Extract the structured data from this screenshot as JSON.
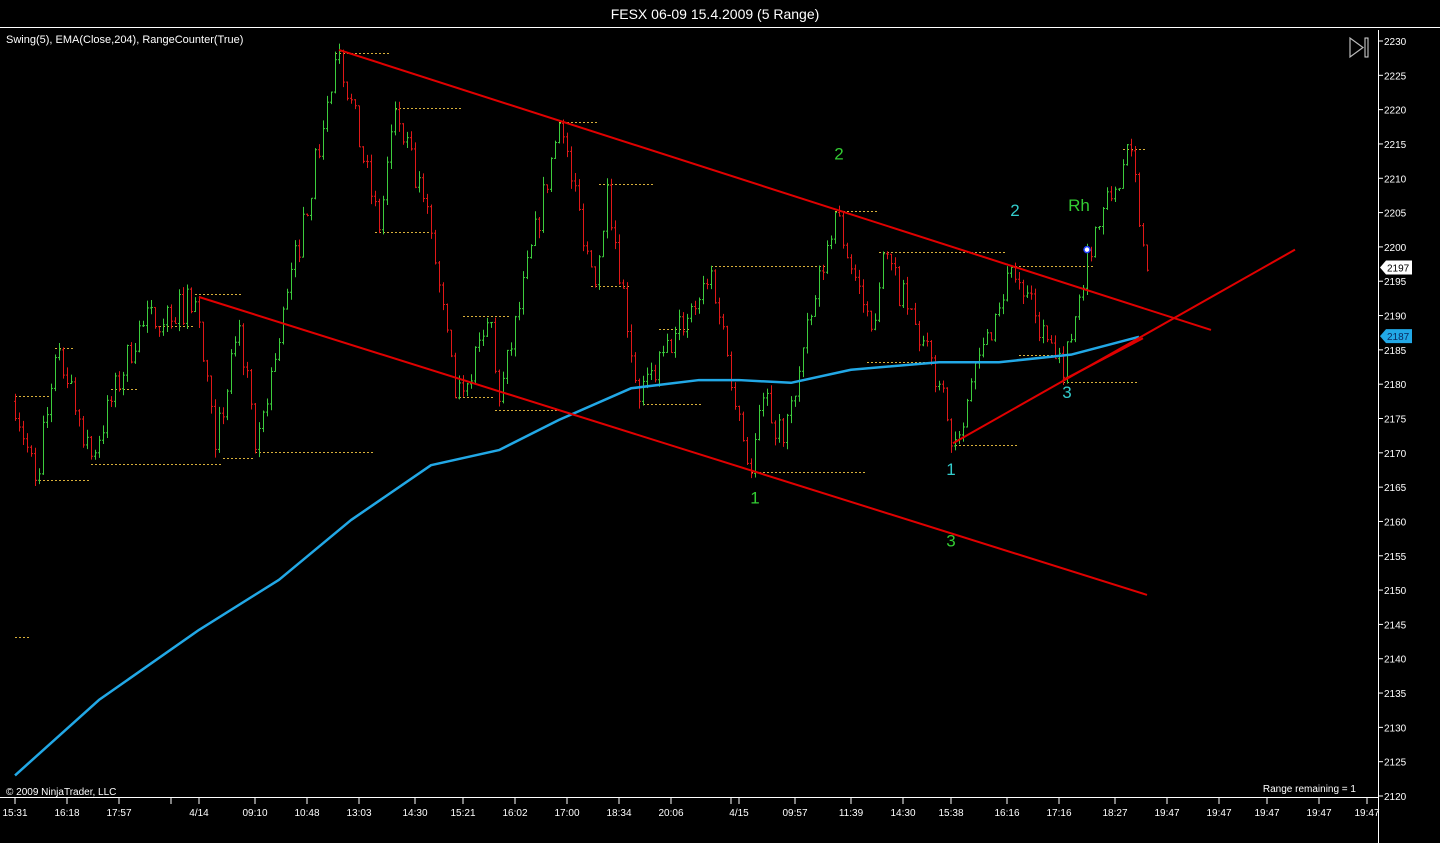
{
  "window": {
    "title": "FESX 06-09  15.4.2009 (5 Range)"
  },
  "indicators_label": "Swing(5), EMA(Close,204), RangeCounter(True)",
  "copyright": "© 2009 NinjaTrader, LLC",
  "range_remaining": "Range remaining = 1",
  "colors": {
    "up": "#3ccc3c",
    "down": "#e01818",
    "ema": "#22a8e6",
    "trend": "#e00000",
    "swing": "#d8b03a",
    "green_label": "#33cc33",
    "cyan_label": "#33cccc"
  },
  "chart_data": {
    "type": "line",
    "title": "FESX 06-09  15.4.2009 (5 Range)",
    "ylim": [
      2120,
      2230
    ],
    "yticks": [
      2230,
      2225,
      2220,
      2215,
      2210,
      2205,
      2200,
      2195,
      2190,
      2185,
      2180,
      2175,
      2170,
      2165,
      2160,
      2155,
      2150,
      2145,
      2140,
      2135,
      2130,
      2125,
      2120
    ],
    "xlim_bars": [
      0,
      340
    ],
    "xticks": [
      {
        "bar": 0,
        "label": "15:31"
      },
      {
        "bar": 13,
        "label": "16:18"
      },
      {
        "bar": 26,
        "label": "17:57"
      },
      {
        "bar": 39,
        "label": ""
      },
      {
        "bar": 46,
        "label": "4/14"
      },
      {
        "bar": 60,
        "label": "09:10"
      },
      {
        "bar": 73,
        "label": "10:48"
      },
      {
        "bar": 86,
        "label": "13:03"
      },
      {
        "bar": 100,
        "label": "14:30"
      },
      {
        "bar": 112,
        "label": "15:21"
      },
      {
        "bar": 125,
        "label": "16:02"
      },
      {
        "bar": 138,
        "label": "17:00"
      },
      {
        "bar": 151,
        "label": "18:34"
      },
      {
        "bar": 164,
        "label": "20:06"
      },
      {
        "bar": 179,
        "label": ""
      },
      {
        "bar": 181,
        "label": "4/15"
      },
      {
        "bar": 195,
        "label": "09:57"
      },
      {
        "bar": 209,
        "label": "11:39"
      },
      {
        "bar": 222,
        "label": "14:30"
      },
      {
        "bar": 234,
        "label": "15:38"
      },
      {
        "bar": 248,
        "label": "16:16"
      },
      {
        "bar": 261,
        "label": "17:16"
      },
      {
        "bar": 275,
        "label": "18:27"
      },
      {
        "bar": 288,
        "label": "19:47"
      },
      {
        "bar": 301,
        "label": "19:47"
      },
      {
        "bar": 313,
        "label": "19:47"
      },
      {
        "bar": 326,
        "label": "19:47"
      },
      {
        "bar": 338,
        "label": "19:47"
      }
    ],
    "price_path": [
      [
        0,
        2177.5
      ],
      [
        5,
        2166
      ],
      [
        11,
        2185
      ],
      [
        19,
        2169.5
      ],
      [
        31,
        2188.5
      ],
      [
        45,
        2192
      ],
      [
        50,
        2170.5
      ],
      [
        56,
        2188.5
      ],
      [
        60,
        2170.5
      ],
      [
        81,
        2228.5
      ],
      [
        91,
        2202.5
      ],
      [
        95,
        2220
      ],
      [
        104,
        2202
      ],
      [
        110,
        2178
      ],
      [
        119,
        2189
      ],
      [
        121,
        2177.5
      ],
      [
        136,
        2218
      ],
      [
        145,
        2194.5
      ],
      [
        148,
        2209
      ],
      [
        156,
        2177.5
      ],
      [
        174,
        2196.5
      ],
      [
        184,
        2167
      ],
      [
        187,
        2178
      ],
      [
        192,
        2171.5
      ],
      [
        205,
        2205
      ],
      [
        214,
        2188
      ],
      [
        217,
        2199
      ],
      [
        231,
        2180
      ],
      [
        234,
        2171
      ],
      [
        249,
        2197
      ],
      [
        262,
        2181
      ],
      [
        268,
        2199.5
      ],
      [
        279,
        2214
      ],
      [
        283,
        2196.6
      ]
    ],
    "last_price": "2197",
    "ema_last": "2187",
    "series": [
      {
        "name": "EMA(Close,204)",
        "points": [
          [
            0,
            2123
          ],
          [
            21,
            2134
          ],
          [
            46,
            2144.2
          ],
          [
            66,
            2151.5
          ],
          [
            84,
            2160.2
          ],
          [
            104,
            2168.2
          ],
          [
            121,
            2170.4
          ],
          [
            136,
            2174.8
          ],
          [
            154,
            2179.4
          ],
          [
            171,
            2180.6
          ],
          [
            181,
            2180.6
          ],
          [
            194,
            2180.2
          ],
          [
            209,
            2182.1
          ],
          [
            231,
            2183.2
          ],
          [
            246,
            2183.2
          ],
          [
            264,
            2184.3
          ],
          [
            281,
            2186.9
          ]
        ]
      }
    ],
    "trend_lines": [
      {
        "from": [
          81,
          2228.7
        ],
        "to": [
          299,
          2187.9
        ]
      },
      {
        "from": [
          46,
          2192.7
        ],
        "to": [
          283,
          2149.3
        ]
      },
      {
        "from": [
          234.5,
          2171.4
        ],
        "to": [
          320,
          2199.6
        ]
      },
      {
        "from": [
          262,
          2180.6
        ],
        "to": [
          282,
          2186.7
        ]
      }
    ],
    "swing_levels": [
      [
        80,
        94,
        2228.2
      ],
      [
        95,
        112,
        2220.2
      ],
      [
        136,
        146,
        2218.2
      ],
      [
        146,
        160,
        2209.2
      ],
      [
        205,
        216,
        2205.2
      ],
      [
        216,
        248,
        2199.3
      ],
      [
        174,
        203,
        2197.2
      ],
      [
        249,
        270,
        2197.2
      ],
      [
        277,
        283,
        2214.3
      ],
      [
        45,
        57,
        2193.1
      ],
      [
        35,
        45,
        2188.5
      ],
      [
        112,
        124,
        2190
      ],
      [
        10,
        15,
        2185.2
      ],
      [
        24,
        31,
        2179.3
      ],
      [
        161,
        169,
        2188.1
      ],
      [
        0,
        9,
        2178.3
      ],
      [
        5,
        19,
        2166
      ],
      [
        19,
        27,
        2168.4
      ],
      [
        27,
        52,
        2168.4
      ],
      [
        52,
        60,
        2169.2
      ],
      [
        60,
        90,
        2170.1
      ],
      [
        90,
        104,
        2202.2
      ],
      [
        144,
        154,
        2194.3
      ],
      [
        110,
        120,
        2178.1
      ],
      [
        120,
        136,
        2176.2
      ],
      [
        157,
        172,
        2177.1
      ],
      [
        184,
        213,
        2167.2
      ],
      [
        213,
        232,
        2183.2
      ],
      [
        235,
        251,
        2171.1
      ],
      [
        251,
        261,
        2184.2
      ],
      [
        262,
        281,
        2180.3
      ],
      [
        0,
        4,
        2143.2
      ]
    ],
    "annotations": [
      {
        "text": "2",
        "bar": 206,
        "price": 2209.5,
        "color": "green"
      },
      {
        "text": "2",
        "bar": 250,
        "price": 2201.3,
        "color": "cyan"
      },
      {
        "text": "Rh",
        "bar": 266,
        "price": 2202,
        "color": "green"
      },
      {
        "text": "3",
        "bar": 263,
        "price": 2174.8,
        "color": "cyan"
      },
      {
        "text": "1",
        "bar": 234,
        "price": 2171.4,
        "color": "cyan",
        "below": true
      },
      {
        "text": "1",
        "bar": 185,
        "price": 2167.3,
        "color": "green",
        "below": true
      },
      {
        "text": "3",
        "bar": 234,
        "price": 2161,
        "color": "green",
        "below": true
      }
    ],
    "marker_dot": {
      "bar": 268,
      "price": 2199.6
    }
  }
}
